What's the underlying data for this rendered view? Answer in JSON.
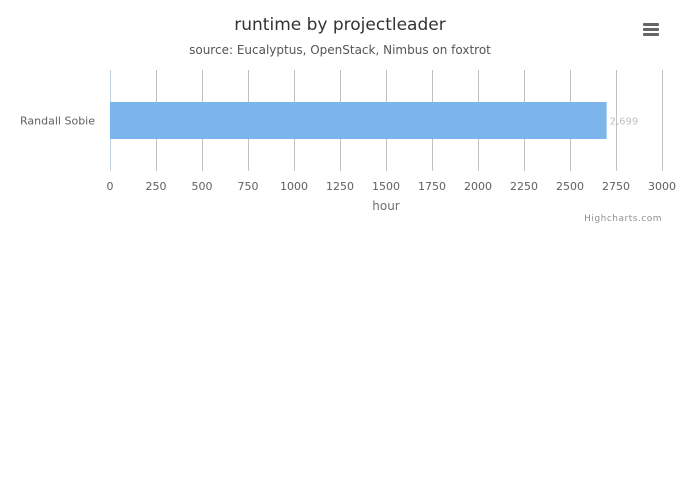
{
  "chart_data": {
    "type": "bar",
    "orientation": "horizontal",
    "title": "runtime by projectleader",
    "subtitle": "source: Eucalyptus, OpenStack, Nimbus on foxtrot",
    "categories": [
      "Randall Sobie"
    ],
    "series": [
      {
        "name": "runtime",
        "values": [
          2699
        ],
        "color": "#7cb5ec"
      }
    ],
    "data_labels": [
      "2,699"
    ],
    "xlabel": "hour",
    "ylabel": "",
    "xlim": [
      0,
      3000
    ],
    "x_ticks": [
      0,
      250,
      500,
      750,
      1000,
      1250,
      1500,
      1750,
      2000,
      2250,
      2500,
      2750,
      3000
    ],
    "grid": true,
    "legend": "none"
  },
  "menu": {
    "icon": "hamburger-menu-icon"
  },
  "credits": "Highcharts.com"
}
